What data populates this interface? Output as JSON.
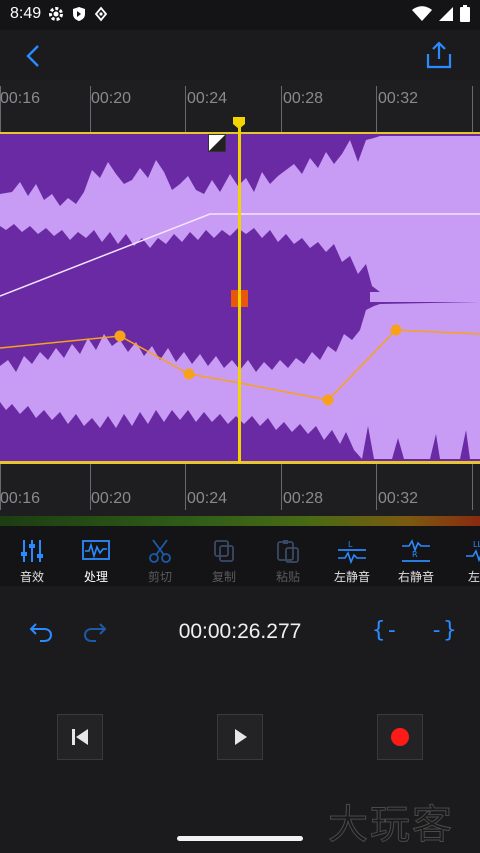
{
  "status_bar": {
    "time": "8:49",
    "icons": [
      "gear-icon",
      "shield-icon",
      "download-status-icon",
      "wifi-icon",
      "signal-icon",
      "battery-icon"
    ]
  },
  "header": {
    "back_icon": "chevron-left-icon",
    "share_icon": "share-upload-icon",
    "accent_color": "#2a8bff"
  },
  "timeline": {
    "ticks": [
      "00:16",
      "00:20",
      "00:24",
      "00:28",
      "00:32"
    ],
    "waveform_color": "#c89cf4",
    "background_color": "#6a2aa4",
    "selection_border_color": "#e6c62e",
    "playhead_color": "#f1d400"
  },
  "toolbar": {
    "items": [
      {
        "label": "音效",
        "icon": "equalizer-sliders-icon",
        "state": "normal"
      },
      {
        "label": "处理",
        "icon": "waveform-process-icon",
        "state": "active"
      },
      {
        "label": "剪切",
        "icon": "scissors-icon",
        "state": "disabled"
      },
      {
        "label": "复制",
        "icon": "copy-icon",
        "state": "disabled"
      },
      {
        "label": "粘贴",
        "icon": "paste-icon",
        "state": "disabled"
      },
      {
        "label": "左静音",
        "icon": "left-channel-mute-icon",
        "state": "normal"
      },
      {
        "label": "右静音",
        "icon": "right-channel-mute-icon",
        "state": "normal"
      },
      {
        "label": "左模",
        "icon": "left-mode-icon",
        "state": "normal"
      }
    ]
  },
  "controls": {
    "timecode": "00:00:26.277",
    "undo_icon": "undo-icon",
    "redo_icon": "redo-icon",
    "select_left": "{-",
    "select_right": "-}"
  },
  "transport": {
    "prev_icon": "skip-to-start-icon",
    "play_icon": "play-icon",
    "record_icon": "record-icon",
    "record_color": "#ff1a1a"
  },
  "watermark": "大玩客"
}
